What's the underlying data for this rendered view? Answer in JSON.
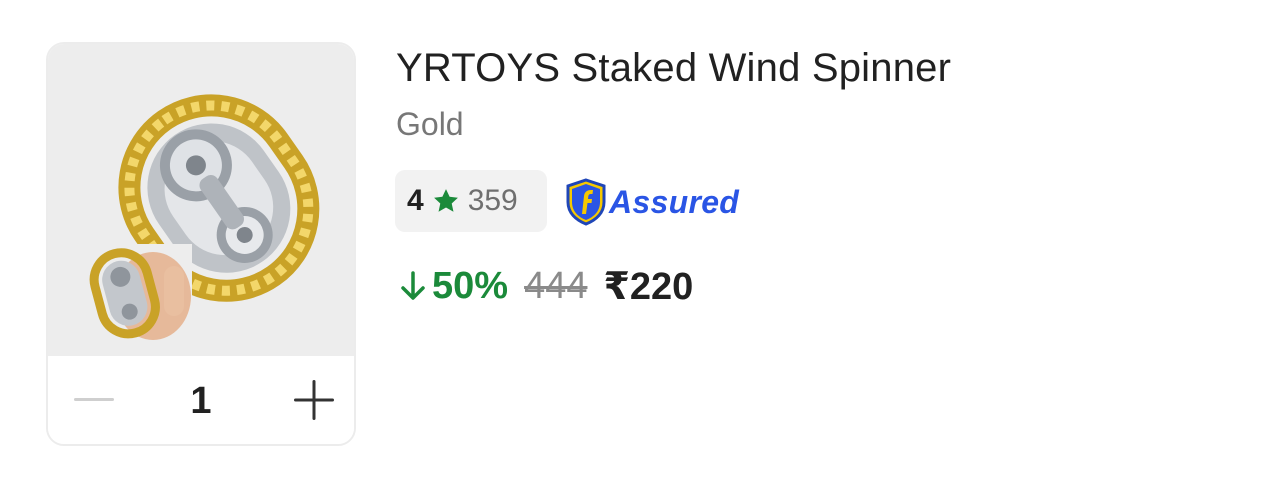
{
  "product": {
    "title": "YRTOYS Staked Wind Spinner",
    "variant": "Gold",
    "image_alt": "gold chain fidget spinner"
  },
  "rating": {
    "value": "4",
    "count": "359",
    "star_icon": "star-icon",
    "star_color": "#1b8a3a"
  },
  "badge": {
    "label": "Assured",
    "icon": "assured-shield-icon",
    "color": "#2a55e5"
  },
  "pricing": {
    "discount": "50%",
    "mrp": "444",
    "price": "₹220",
    "discount_color": "#1b8a3a"
  },
  "quantity": {
    "value": "1",
    "decrement_icon": "minus-icon",
    "increment_icon": "plus-icon"
  }
}
